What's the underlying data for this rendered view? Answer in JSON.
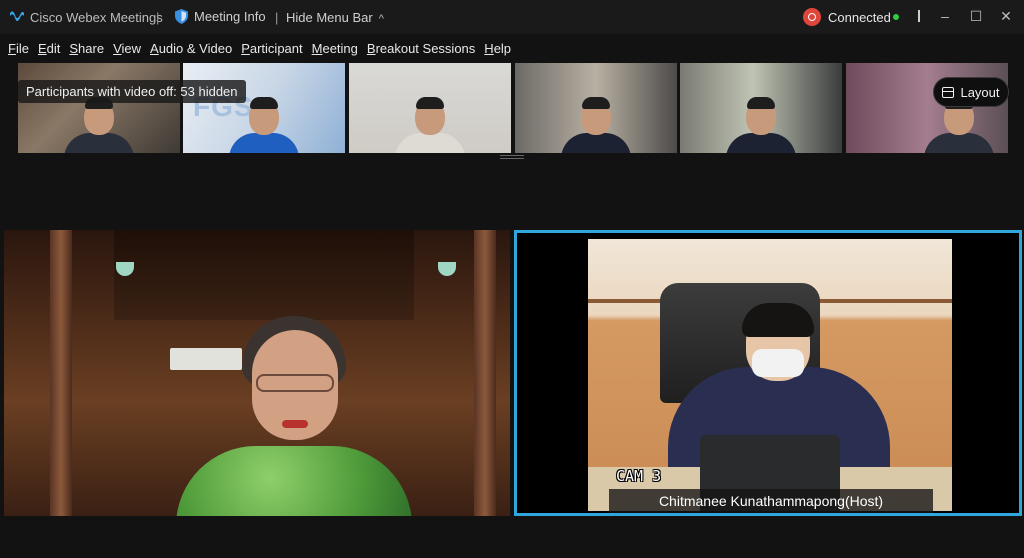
{
  "titlebar": {
    "app_title": "Cisco Webex Meetings",
    "separator": "|",
    "meeting_info": "Meeting Info",
    "hide_menu_bar": "Hide Menu Bar",
    "hide_menu_chevron": "^",
    "status": "Connected",
    "status_color": "#2ecc40",
    "record_color": "#e0453a",
    "minimize": "–",
    "maximize": "☐",
    "close": "✕"
  },
  "menubar": {
    "items": [
      {
        "u": "F",
        "rest": "ile"
      },
      {
        "u": "E",
        "rest": "dit"
      },
      {
        "u": "S",
        "rest": "hare"
      },
      {
        "u": "V",
        "rest": "iew"
      },
      {
        "u": "A",
        "rest": "udio & Video"
      },
      {
        "u": "P",
        "rest": "articipant"
      },
      {
        "u": "M",
        "rest": "eeting"
      },
      {
        "u": "B",
        "rest": "reakout Sessions"
      },
      {
        "u": "H",
        "rest": "elp"
      }
    ]
  },
  "filmstrip": {
    "video_off_notice": "Participants with video off: 53 hidden",
    "fgs_text": "FGS",
    "layout_button": "Layout"
  },
  "main": {
    "right_cam_label": "CAM 3",
    "right_name": "Chitmanee Kunathammapong(Host)",
    "active_border_color": "#2fa7dd"
  }
}
